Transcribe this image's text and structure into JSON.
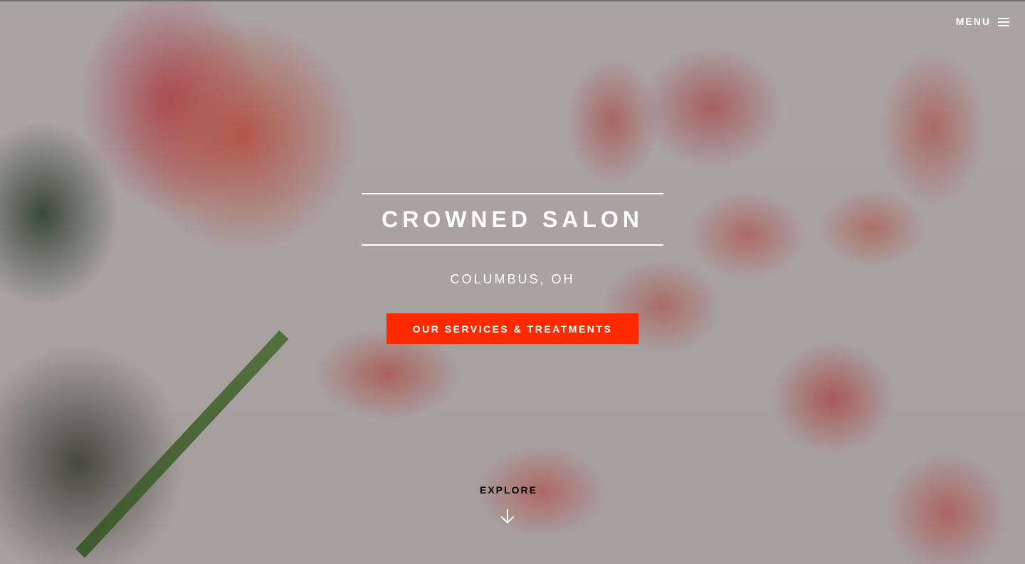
{
  "header": {
    "menu_label": "MENU",
    "menu_icon": "hamburger-icon"
  },
  "hero": {
    "title": "CROWNED SALON",
    "subtitle": "COLUMBUS, OH",
    "cta_label": "OUR SERVICES & TREATMENTS",
    "explore_label": "EXPLORE",
    "explore_icon": "arrow-down-icon"
  },
  "colors": {
    "accent": "#ff2a00",
    "text": "#ffffff"
  }
}
